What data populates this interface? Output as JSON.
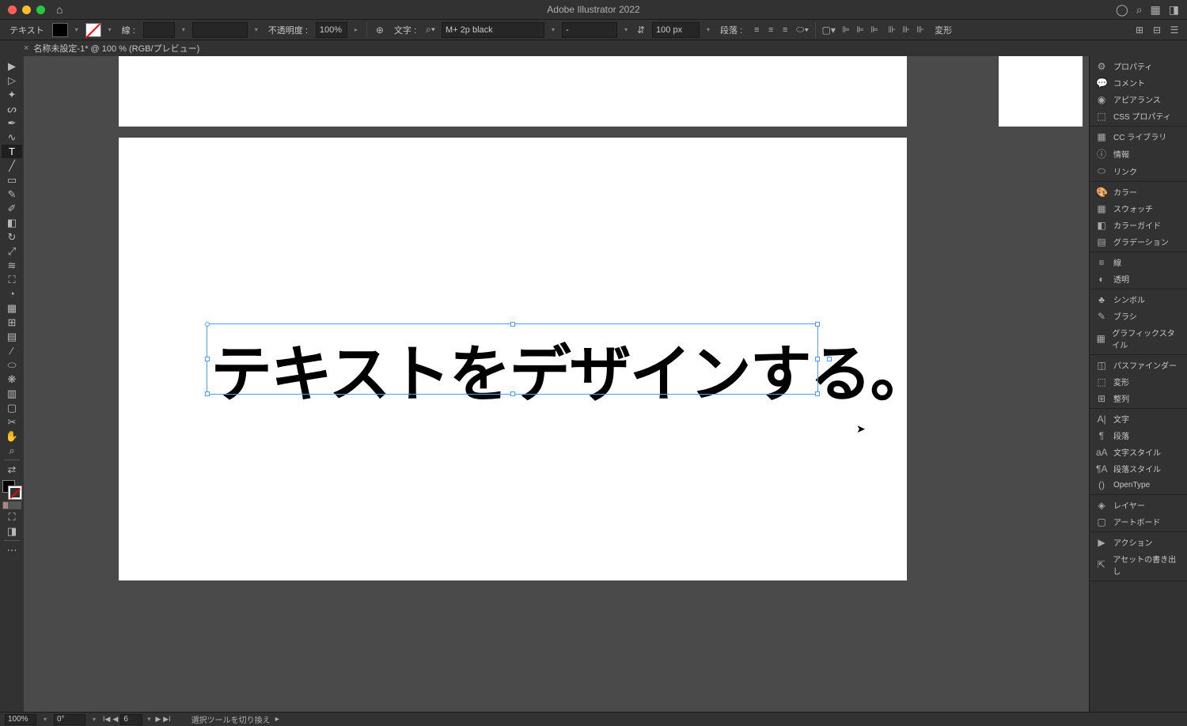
{
  "app_title": "Adobe Illustrator 2022",
  "control_bar": {
    "mode_label": "テキスト",
    "stroke_label": "線 :",
    "opacity_label": "不透明度 :",
    "opacity_value": "100%",
    "char_label": "文字 :",
    "font_name": "M+ 2p black",
    "font_style": "-",
    "font_size": "100 px",
    "para_label": "段落 :",
    "transform_label": "変形"
  },
  "doc_tab": {
    "name": "名称未設定-1* @ 100 % (RGB/プレビュー)"
  },
  "canvas": {
    "text": "テキストをデザインする。"
  },
  "panels": [
    [
      {
        "icon": "⚙",
        "label": "プロパティ"
      },
      {
        "icon": "💬",
        "label": "コメント"
      },
      {
        "icon": "◉",
        "label": "アピアランス"
      },
      {
        "icon": "⬚",
        "label": "CSS プロパティ"
      }
    ],
    [
      {
        "icon": "▦",
        "label": "CC ライブラリ"
      },
      {
        "icon": "ⓘ",
        "label": "情報"
      },
      {
        "icon": "⬭",
        "label": "リンク"
      }
    ],
    [
      {
        "icon": "🎨",
        "label": "カラー"
      },
      {
        "icon": "▦",
        "label": "スウォッチ"
      },
      {
        "icon": "◧",
        "label": "カラーガイド"
      },
      {
        "icon": "▤",
        "label": "グラデーション"
      }
    ],
    [
      {
        "icon": "≡",
        "label": "線"
      },
      {
        "icon": "◐",
        "label": "透明"
      }
    ],
    [
      {
        "icon": "♣",
        "label": "シンボル"
      },
      {
        "icon": "✎",
        "label": "ブラシ"
      },
      {
        "icon": "▦",
        "label": "グラフィックスタイル"
      }
    ],
    [
      {
        "icon": "◫",
        "label": "パスファインダー"
      },
      {
        "icon": "⬚",
        "label": "変形"
      },
      {
        "icon": "⊞",
        "label": "整列"
      }
    ],
    [
      {
        "icon": "A|",
        "label": "文字"
      },
      {
        "icon": "¶",
        "label": "段落"
      },
      {
        "icon": "aA",
        "label": "文字スタイル"
      },
      {
        "icon": "¶A",
        "label": "段落スタイル"
      },
      {
        "icon": "()",
        "label": "OpenType"
      }
    ],
    [
      {
        "icon": "◈",
        "label": "レイヤー"
      },
      {
        "icon": "▢",
        "label": "アートボード"
      }
    ],
    [
      {
        "icon": "▶",
        "label": "アクション"
      },
      {
        "icon": "⇱",
        "label": "アセットの書き出し"
      }
    ]
  ],
  "status": {
    "zoom": "100%",
    "rotation": "0°",
    "artboard": "6",
    "tool_hint": "選択ツールを切り換え"
  }
}
